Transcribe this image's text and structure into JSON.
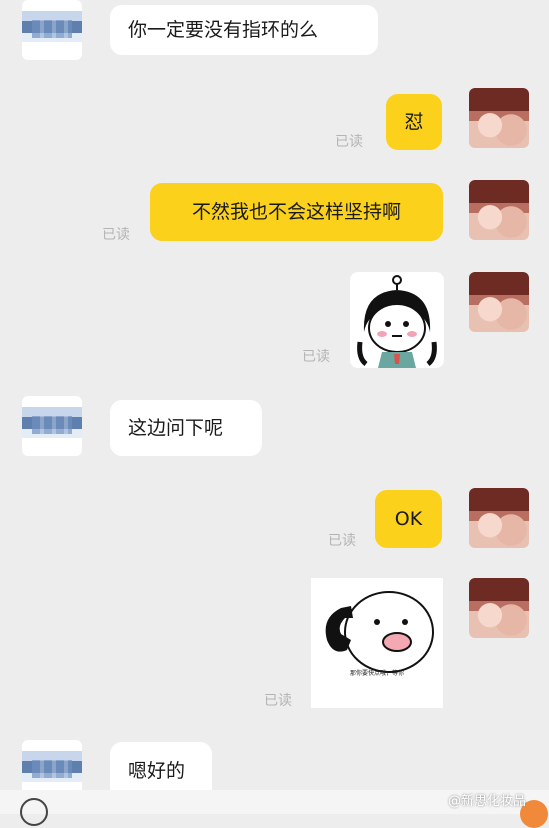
{
  "messages": [
    {
      "side": "in",
      "text": "你一定要没有指环的么"
    },
    {
      "side": "out",
      "text": "怼",
      "read": "已读"
    },
    {
      "side": "out",
      "text": "不然我也不会这样坚持啊",
      "read": "已读"
    },
    {
      "side": "out",
      "sticker": "crying-girl-sticker",
      "read": "已读"
    },
    {
      "side": "in",
      "text": "这边问下呢"
    },
    {
      "side": "out",
      "text": "OK",
      "read": "已读"
    },
    {
      "side": "out",
      "sticker": "phone-call-sticker",
      "sticker_caption": "那你要快点哦，等你",
      "read": "已读"
    },
    {
      "side": "in",
      "text": "嗯好的"
    }
  ],
  "watermark": "@新思化妆品",
  "colors": {
    "background": "#ededed",
    "outgoing": "#fbd11b",
    "incoming": "#ffffff",
    "read_receipt": "#b4b4b4"
  }
}
